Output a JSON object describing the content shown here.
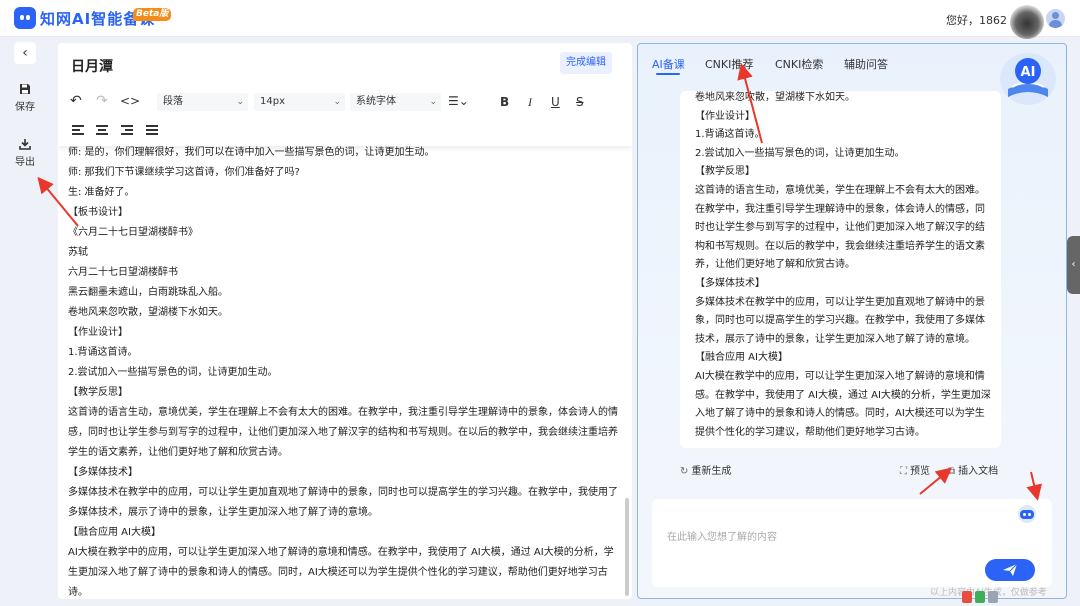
{
  "app": {
    "name": "知网AI智能备课",
    "badge": "Beta版",
    "greeting": "您好，1862"
  },
  "sidebar": {
    "collapse_glyph": "‹",
    "save_label": "保存",
    "export_label": "导出"
  },
  "editor": {
    "title": "日月潭",
    "finish_button": "完成编辑",
    "toolbar": {
      "paragraph": "段落",
      "font_size": "14px",
      "font_family": "系统字体",
      "bold": "B",
      "italic": "I",
      "underline": "U",
      "strike": "S"
    },
    "lines": [
      "师: 是的，你们理解很好，我们可以在诗中加入一些描写景色的词，让诗更加生动。",
      "师: 那我们下节课继续学习这首诗，你们准备好了吗?",
      "生: 准备好了。",
      "【板书设计】",
      "《六月二十七日望湖楼醉书》",
      "苏轼",
      "六月二十七日望湖楼醉书",
      "黑云翻墨未遮山，白雨跳珠乱入船。",
      "卷地风来忽吹散，望湖楼下水如天。",
      "【作业设计】",
      "1.背诵这首诗。",
      "2.尝试加入一些描写景色的词，让诗更加生动。",
      "【教学反思】",
      "这首诗的语言生动，意境优美，学生在理解上不会有太大的困难。在教学中，我注重引导学生理解诗中的景象，体会诗人的情感，同时也让学生参与到写字的过程中，让他们更加深入地了解汉字的结构和书写规则。在以后的教学中，我会继续注重培养学生的语文素养，让他们更好地了解和欣赏古诗。",
      "【多媒体技术】",
      "多媒体技术在教学中的应用，可以让学生更加直观地了解诗中的景象，同时也可以提高学生的学习兴趣。在教学中，我使用了多媒体技术，展示了诗中的景象，让学生更加深入地了解了诗的意境。",
      "【融合应用 AI大模】",
      "AI大模在教学中的应用，可以让学生更加深入地了解诗的意境和情感。在教学中，我使用了 AI大模，通过 AI大模的分析，学生更加深入地了解了诗中的景象和诗人的情感。同时，AI大模还可以为学生提供个性化的学习建议，帮助他们更好地学习古诗。"
    ]
  },
  "ai_panel": {
    "tabs": [
      "AI备课",
      "CNKI推荐",
      "CNKI检索",
      "辅助问答"
    ],
    "active_tab": 0,
    "badge_text": "AI",
    "answer_lines": [
      "卷地风来忽吹散，望湖楼下水如天。",
      "【作业设计】",
      "1.背诵这首诗。",
      "2.尝试加入一些描写景色的词，让诗更加生动。",
      "【教学反思】",
      "这首诗的语言生动，意境优美，学生在理解上不会有太大的困难。在教学中，我注重引导学生理解诗中的景象，体会诗人的情感，同时也让学生参与到写字的过程中，让他们更加深入地了解汉字的结构和书写规则。在以后的教学中，我会继续注重培养学生的语文素养，让他们更好地了解和欣赏古诗。",
      "【多媒体技术】",
      "多媒体技术在教学中的应用，可以让学生更加直观地了解诗中的景象，同时也可以提高学生的学习兴趣。在教学中，我使用了多媒体技术，展示了诗中的景象，让学生更加深入地了解了诗的意境。",
      "【融合应用 AI大模】",
      "AI大模在教学中的应用，可以让学生更加深入地了解诗的意境和情感。在教学中，我使用了 AI大模，通过 AI大模的分析，学生更加深入地了解了诗中的景象和诗人的情感。同时，AI大模还可以为学生提供个性化的学习建议，帮助他们更好地学习古诗。"
    ],
    "regenerate": "重新生成",
    "preview": "预览",
    "insert_doc": "插入文档",
    "input_placeholder": "在此输入您想了解的内容"
  },
  "footer_note": "以上内容由AI生成，仅做参考",
  "colors": {
    "accent": "#2a63f5",
    "panel_border": "#8bb6e8",
    "annotation_arrow": "#e8382b"
  }
}
